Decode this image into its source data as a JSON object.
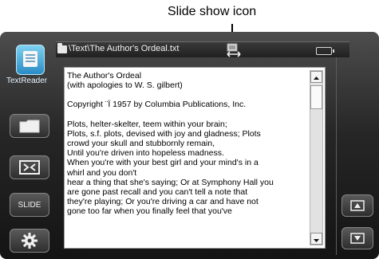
{
  "annotation": {
    "label": "Slide show icon"
  },
  "titlebar": {
    "path": "\\Text\\The Author's Ordeal.txt"
  },
  "app": {
    "name": "TextReader"
  },
  "sidebar": {
    "buttons": [
      {
        "icon": "folder-icon",
        "label": ""
      },
      {
        "icon": "fullscreen-icon",
        "label": ""
      },
      {
        "icon": "",
        "label": "SLIDE"
      },
      {
        "icon": "gear-icon",
        "label": ""
      }
    ]
  },
  "document": {
    "lines": [
      "The Author's Ordeal",
      "(with apologies to W. S. gilbert)",
      "",
      "Copyright ¨Ï 1957 by Columbia Publications, Inc.",
      "",
      "Plots, helter-skelter, teem within your brain;",
      "Plots, s.f. plots, devised with joy and gladness; Plots",
      "crowd your skull and stubbornly remain,",
      "Until you're driven into hopeless madness.",
      "When you're with your best girl and your mind's in a",
      "whirl and you don't",
      "hear a thing that she's saying; Or at Symphony Hall you",
      "are gone past recall and you can't tell a note that",
      "they're playing; Or you're driving a car and have not",
      "gone too far when you finally feel that you've"
    ]
  },
  "rightbar": {
    "buttons": [
      {
        "icon": "scroll-up-icon"
      },
      {
        "icon": "scroll-down-icon"
      }
    ]
  },
  "colors": {
    "frame": "#262626",
    "app_icon": "#2a8cc5",
    "panel": "#ffffff"
  }
}
